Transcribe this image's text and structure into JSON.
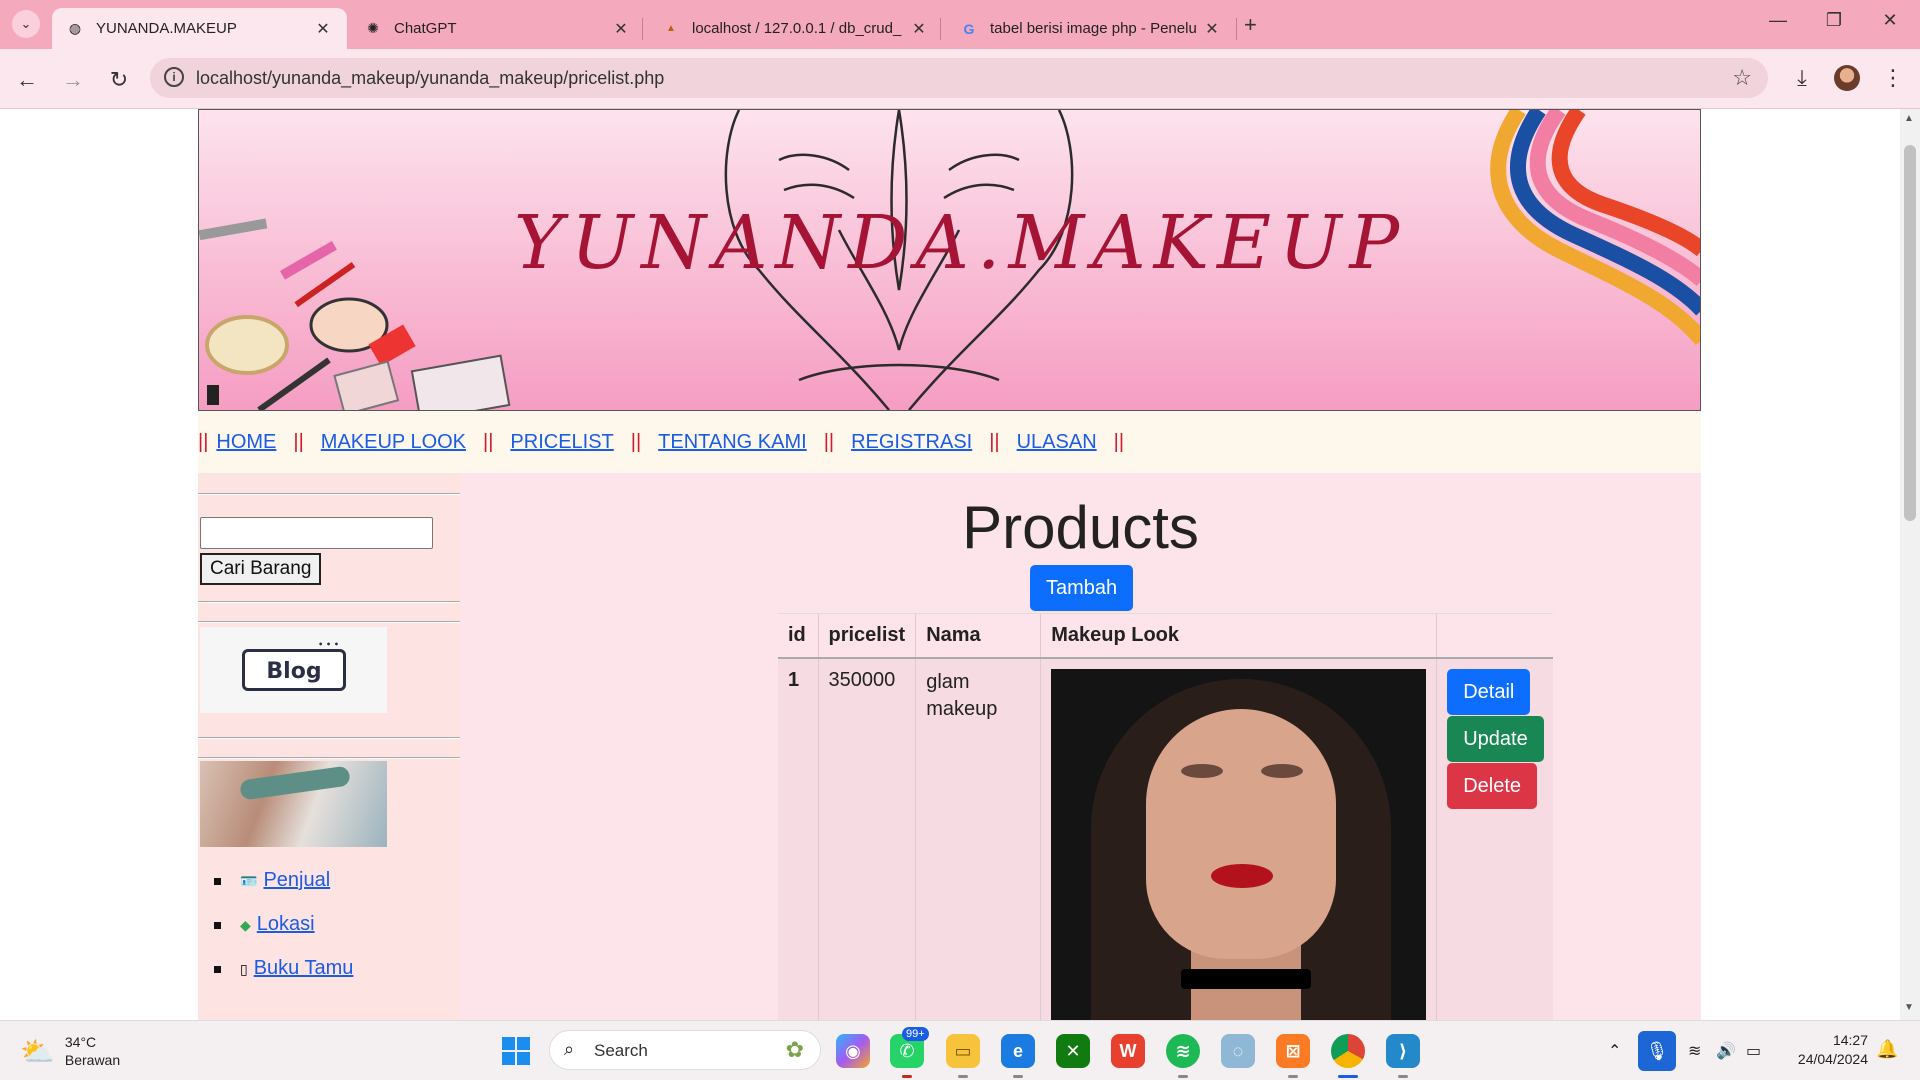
{
  "browser": {
    "tabs": [
      {
        "title": "YUNANDA.MAKEUP",
        "favicon": "globe-icon",
        "active": true
      },
      {
        "title": "ChatGPT",
        "favicon": "chatgpt-icon",
        "active": false
      },
      {
        "title": "localhost / 127.0.0.1 / db_crud_",
        "favicon": "phpmyadmin-icon",
        "active": false
      },
      {
        "title": "tabel berisi image php - Penelu",
        "favicon": "google-icon",
        "active": false
      }
    ],
    "url": "localhost/yunanda_makeup/yunanda_makeup/pricelist.php"
  },
  "banner": {
    "brand": "YUNANDA.MAKEUP"
  },
  "menu": {
    "separator": "||",
    "items": [
      "HOME",
      "MAKEUP LOOK",
      "PRICELIST",
      "TENTANG KAMI",
      "REGISTRASI",
      "ULASAN"
    ]
  },
  "sidebar": {
    "search_value": "",
    "search_button": "Cari Barang",
    "blog_logo": "Blog",
    "links": [
      {
        "label": "Penjual",
        "icon": "id-card-icon"
      },
      {
        "label": "Lokasi",
        "icon": "map-pin-icon"
      },
      {
        "label": "Buku Tamu",
        "icon": "guestbook-icon"
      }
    ]
  },
  "main": {
    "title": "Products",
    "add_button": "Tambah",
    "table": {
      "headers": [
        "id",
        "pricelist",
        "Nama",
        "Makeup Look",
        ""
      ],
      "rows": [
        {
          "id": "1",
          "pricelist": "350000",
          "nama": "glam makeup",
          "image": "glam-makeup-portrait"
        }
      ]
    },
    "actions": {
      "detail": "Detail",
      "update": "Update",
      "delete": "Delete"
    }
  },
  "taskbar": {
    "weather_temp": "34°C",
    "weather_desc": "Berawan",
    "search_label": "Search",
    "whatsapp_badge": "99+",
    "time": "14:27",
    "date": "24/04/2024"
  },
  "colors": {
    "tab_bar": "#f5a9bd",
    "brand_text": "#a51435",
    "menu_separator": "#d11a2a",
    "link": "#1a5ce6",
    "btn_primary": "#0d6efd",
    "btn_success": "#198754",
    "btn_danger": "#dc3545"
  }
}
